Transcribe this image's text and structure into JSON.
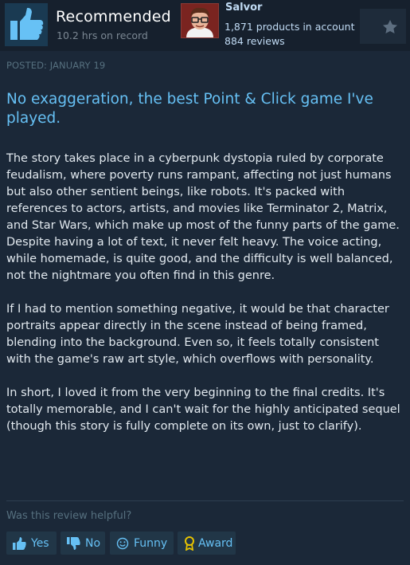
{
  "review": {
    "recommendation": "Recommended",
    "hours": "10.2 hrs on record",
    "posted": "POSTED: JANUARY 19",
    "headline": "No exaggeration, the best Point & Click game I've played.",
    "paragraphs": [
      "The story takes place in a cyberpunk dystopia ruled by corporate feudalism, where poverty runs rampant, affecting not just humans but also other sentient beings, like robots. It's packed with references to actors, artists, and movies like Terminator 2, Matrix, and Star Wars, which make up most of the funny parts of the game.",
      "Despite having a lot of text, it never felt heavy. The voice acting, while homemade, is quite good, and the difficulty is well balanced, not the nightmare you often find in this genre.",
      "If I had to mention something negative, it would be that character portraits appear directly in the scene instead of being framed, blending into the background. Even so, it feels totally consistent with the game's raw art style, which overflows with personality.",
      "In short, I loved it from the very beginning to the final credits. It's totally memorable, and I can't wait for the highly anticipated sequel (though this story is fully complete on its own, just to clarify)."
    ]
  },
  "user": {
    "name": "Salvor",
    "products": "1,871 products in account",
    "reviews": "884 reviews"
  },
  "footer": {
    "question": "Was this review helpful?",
    "yes_label": "Yes",
    "no_label": "No",
    "funny_label": "Funny",
    "award_label": "Award"
  },
  "icons": {
    "recommend": "thumbs-up-icon",
    "award": "star-icon",
    "yes": "thumbs-up-icon",
    "no": "thumbs-down-icon",
    "funny": "smiley-icon",
    "award_btn": "award-ribbon-icon"
  },
  "colors": {
    "background": "#1b2838",
    "header_bg": "#16202d",
    "accent": "#66c0f4",
    "award": "#e6c200"
  }
}
